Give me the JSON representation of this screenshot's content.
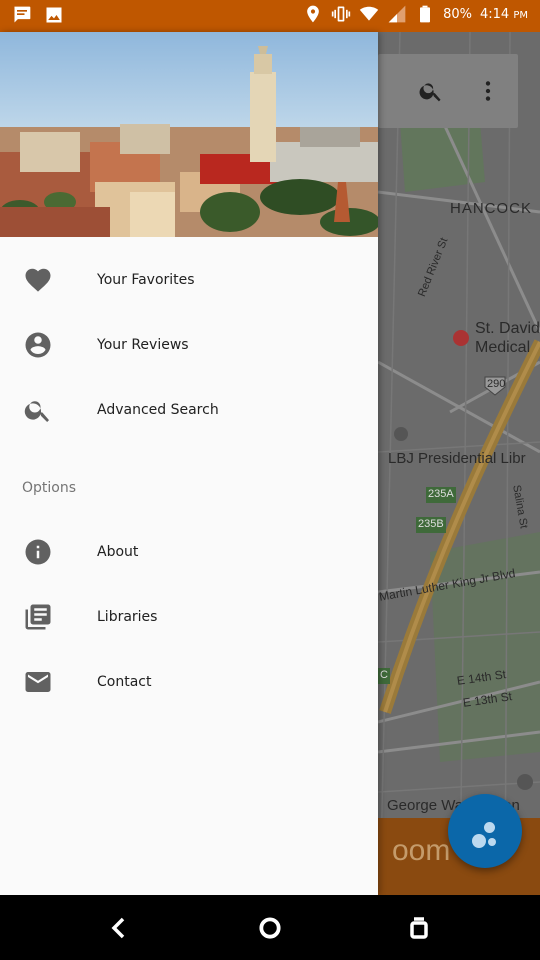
{
  "status_bar": {
    "battery": "80%",
    "time": "4:14",
    "ampm": "PM",
    "icons": [
      "message-icon",
      "image-icon",
      "location-icon",
      "vibrate-icon",
      "wifi-icon",
      "signal-icon",
      "battery-icon"
    ]
  },
  "map": {
    "labels": {
      "hancock": "HANCOCK",
      "red_river": "Red River St",
      "st_david_1": "St. David",
      "st_david_2": "Medical",
      "hwy_290": "290",
      "lbj": "LBJ Presidential Libr",
      "exit_235a": "235A",
      "exit_235b": "235B",
      "salina": "Salina St",
      "mlk": "Martin Luther King Jr Blvd",
      "e14": "E 14th St",
      "e13": "E 13th St",
      "washington": "George Washington",
      "exit_c": "C",
      "bottom_text": "oom"
    }
  },
  "drawer": {
    "menu": [
      {
        "label": "Your Favorites",
        "icon": "heart-icon"
      },
      {
        "label": "Your Reviews",
        "icon": "account-circle-icon"
      },
      {
        "label": "Advanced Search",
        "icon": "search-icon"
      }
    ],
    "options_title": "Options",
    "options": [
      {
        "label": "About",
        "icon": "info-icon"
      },
      {
        "label": "Libraries",
        "icon": "library-books-icon"
      },
      {
        "label": "Contact",
        "icon": "mail-icon"
      }
    ]
  },
  "colors": {
    "brand": "#bf5700",
    "fab": "#0b67a9"
  }
}
